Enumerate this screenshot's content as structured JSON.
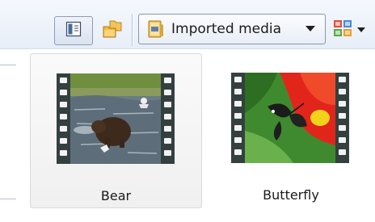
{
  "toolbar": {
    "view_toggle_icon": "details-pane-icon",
    "folders_icon": "folders-icon",
    "location_dropdown": {
      "icon": "folder-icon",
      "selected": "Imported media",
      "arrow_icon": "dropdown-arrow-icon"
    },
    "view_mode_icon": "view-mode-icon"
  },
  "media": [
    {
      "title": "Bear",
      "selected": true,
      "thumbnail_icon": "video-film-icon"
    },
    {
      "title": "Butterfly",
      "selected": false,
      "thumbnail_icon": "video-film-icon"
    }
  ],
  "colors": {
    "toolbar_bg": "#e8eef8",
    "selection_border": "#d9d9d9",
    "film_strip": "#2f3d3d"
  }
}
